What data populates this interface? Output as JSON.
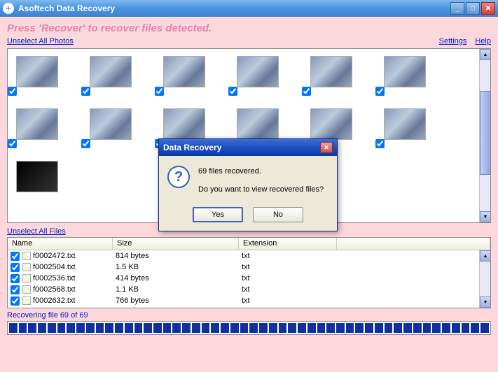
{
  "titlebar": {
    "title": "Asoftech Data Recovery"
  },
  "instruction": "Press 'Recover' to recover files detected.",
  "links": {
    "unselect_photos": "Unselect All Photos",
    "unselect_files": "Unselect All Files",
    "settings": "Settings",
    "help": "Help"
  },
  "photos_count": 12,
  "files": {
    "headers": {
      "name": "Name",
      "size": "Size",
      "ext": "Extension"
    },
    "rows": [
      {
        "name": "f0002472.txt",
        "size": "814 bytes",
        "ext": "txt"
      },
      {
        "name": "f0002504.txt",
        "size": "1.5 KB",
        "ext": "txt"
      },
      {
        "name": "f0002536.txt",
        "size": "414 bytes",
        "ext": "txt"
      },
      {
        "name": "f0002568.txt",
        "size": "1.1 KB",
        "ext": "txt"
      },
      {
        "name": "f0002632.txt",
        "size": "766 bytes",
        "ext": "txt"
      }
    ]
  },
  "status": "Recovering file 69 of 69",
  "progress_segments": 50,
  "dialog": {
    "title": "Data Recovery",
    "line1": "69 files recovered.",
    "line2": "Do you want to view recovered files?",
    "yes": "Yes",
    "no": "No"
  }
}
